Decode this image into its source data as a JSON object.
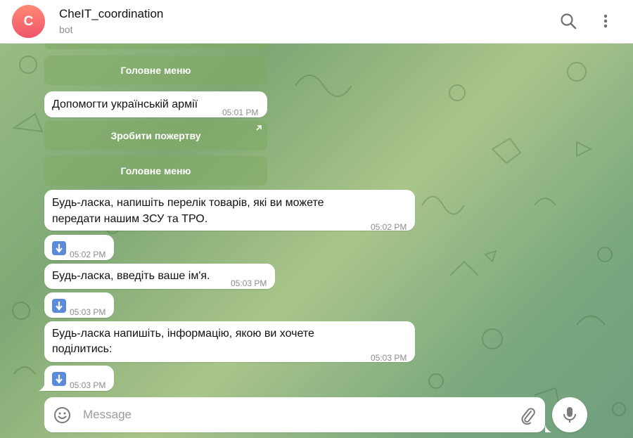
{
  "header": {
    "avatar_letter": "C",
    "title": "CheIT_coordination",
    "subtitle": "bot",
    "search_icon": "search-icon",
    "more_icon": "more-vertical-icon"
  },
  "colors": {
    "avatar_start": "#ff8a74",
    "avatar_end": "#f0556c",
    "keyboard_button": "#80aa64",
    "download_icon": "#5b8ad8"
  },
  "messages": {
    "kb_main_menu_1": "Головне меню",
    "msg_help_army": {
      "text": "Допомогти українській армії",
      "time": "05:01 PM"
    },
    "kb_donate": "Зробити пожертву",
    "kb_main_menu_2": "Головне меню",
    "msg_list_goods": {
      "line1": "Будь-ласка, напишіть перелік товарів, які ви можете",
      "line2": "передати нашим ЗСУ та ТРО.",
      "time": "05:02 PM"
    },
    "file_1": {
      "time": "05:02 PM",
      "icon": "download-arrow-icon"
    },
    "msg_enter_name": {
      "text": "Будь-ласка, введіть ваше ім'я.",
      "time": "05:03 PM"
    },
    "file_2": {
      "time": "05:03 PM",
      "icon": "download-arrow-icon"
    },
    "msg_info": {
      "line1": "Будь-ласка напишіть, інформацію, якою ви хочете",
      "line2": "поділитись:",
      "time": "05:03 PM"
    },
    "file_3": {
      "time": "05:03 PM",
      "icon": "download-arrow-icon"
    }
  },
  "composer": {
    "placeholder": "Message",
    "emoji_icon": "emoji-smile-icon",
    "attach_icon": "paperclip-icon",
    "mic_icon": "microphone-icon"
  }
}
